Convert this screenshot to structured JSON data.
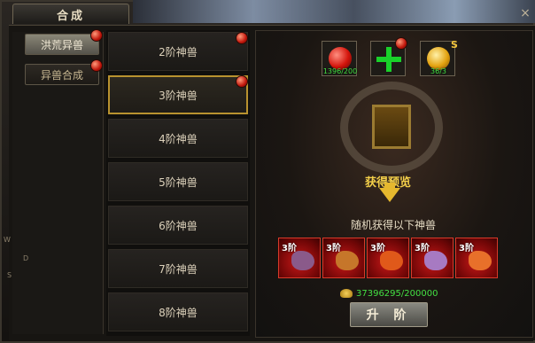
{
  "window": {
    "title": "合成",
    "close_label": "×"
  },
  "sidebar": {
    "nav_letters": [
      "W",
      "D",
      "S"
    ],
    "tabs": [
      {
        "label": "洪荒异兽",
        "active": true,
        "has_alert": true
      },
      {
        "label": "异兽合成",
        "active": false,
        "has_alert": true
      }
    ]
  },
  "list": {
    "items": [
      {
        "label": "2阶神兽",
        "has_alert": true,
        "selected": false
      },
      {
        "label": "3阶神兽",
        "has_alert": true,
        "selected": true
      },
      {
        "label": "4阶神兽",
        "has_alert": false,
        "selected": false
      },
      {
        "label": "5阶神兽",
        "has_alert": false,
        "selected": false
      },
      {
        "label": "6阶神兽",
        "has_alert": false,
        "selected": false
      },
      {
        "label": "7阶神兽",
        "has_alert": false,
        "selected": false
      },
      {
        "label": "8阶神兽",
        "has_alert": false,
        "selected": false
      }
    ]
  },
  "materials": {
    "slot1": {
      "count": "1396/200",
      "icon": "red-orb-icon"
    },
    "slot2": {
      "icon": "plus-icon"
    },
    "slot3": {
      "count": "36/3",
      "icon": "gold-orb-icon"
    },
    "badge": "S"
  },
  "preview": {
    "title": "获得预览",
    "random_label": "随机获得以下神兽",
    "beasts": [
      {
        "level": "3阶",
        "color": "#8a5a8a"
      },
      {
        "level": "3阶",
        "color": "#c6762a"
      },
      {
        "level": "3阶",
        "color": "#e0591a"
      },
      {
        "level": "3阶",
        "color": "#a77ac2"
      },
      {
        "level": "3阶",
        "color": "#e8702a"
      }
    ]
  },
  "cost": {
    "value": "37396295/200000"
  },
  "upgrade_button": {
    "label": "升 阶"
  },
  "colors": {
    "accent_gold": "#b8922f",
    "value_green": "#43e043",
    "alert_red": "#c0160b"
  }
}
